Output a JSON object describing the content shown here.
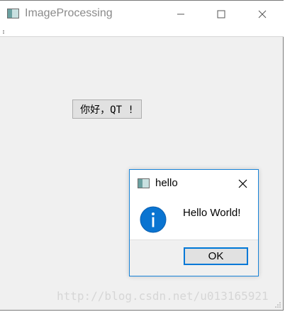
{
  "main_window": {
    "title": "ImageProcessing",
    "icon": "app-window-icon",
    "controls": {
      "minimize_icon": "minimize-icon",
      "maximize_icon": "maximize-icon",
      "close_icon": "close-icon"
    }
  },
  "central": {
    "greeting_button_label": "你好，QT !"
  },
  "message_box": {
    "title": "hello",
    "icon": "information-icon",
    "text": "Hello World!",
    "ok_label": "OK"
  },
  "watermark": {
    "text": "http://blog.csdn.net/u013165921"
  },
  "colors": {
    "accent": "#0078d7",
    "info_icon": "#0a74d1",
    "window_bg": "#f0f0f0"
  }
}
